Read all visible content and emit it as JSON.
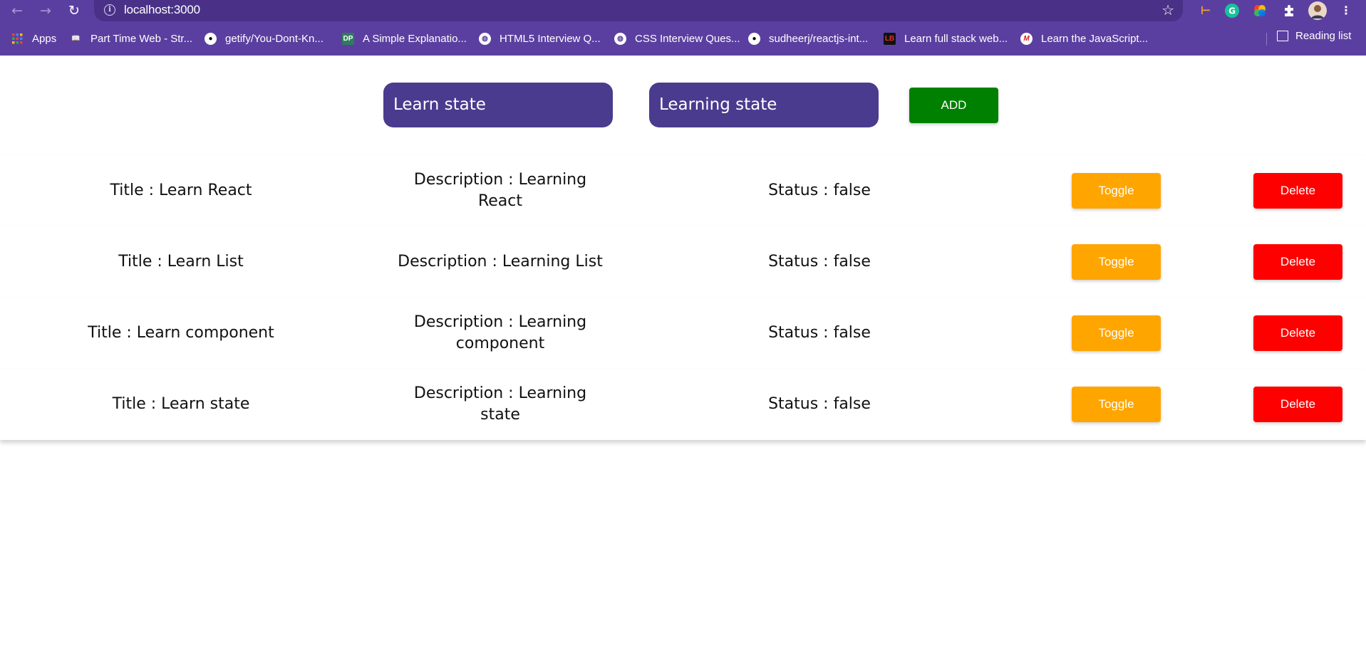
{
  "browser": {
    "url": "localhost:3000",
    "bookmarks": [
      {
        "label": "Apps",
        "icon": "apps-grid-icon"
      },
      {
        "label": "Part Time Web - Str...",
        "icon": "book-icon"
      },
      {
        "label": "getify/You-Dont-Kn...",
        "icon": "github-icon"
      },
      {
        "label": "A Simple Explanatio...",
        "icon": "dp-icon"
      },
      {
        "label": "HTML5 Interview Q...",
        "icon": "globe-icon"
      },
      {
        "label": "CSS Interview Ques...",
        "icon": "globe-icon"
      },
      {
        "label": "sudheerj/reactjs-int...",
        "icon": "github-icon"
      },
      {
        "label": "Learn full stack web...",
        "icon": "lb-icon"
      },
      {
        "label": "Learn the JavaScript...",
        "icon": "m-icon"
      }
    ],
    "reading_list_label": "Reading list",
    "colors": {
      "frame": "#5b3fa0",
      "omnibox": "#4a3187"
    }
  },
  "form": {
    "title_value": "Learn state",
    "description_value": "Learning state",
    "add_label": "ADD",
    "colors": {
      "field": "#4a3b8f",
      "add": "#008000"
    }
  },
  "todos": [
    {
      "title": "Title : Learn React",
      "description": "Description : Learning React",
      "status": "Status : false"
    },
    {
      "title": "Title : Learn List",
      "description": "Description : Learning List",
      "status": "Status : false"
    },
    {
      "title": "Title : Learn component",
      "description": "Description : Learning component",
      "status": "Status : false"
    },
    {
      "title": "Title : Learn state",
      "description": "Description : Learning state",
      "status": "Status : false"
    }
  ],
  "buttons": {
    "toggle_label": "Toggle",
    "delete_label": "Delete",
    "colors": {
      "toggle": "#ffa500",
      "delete": "#ff0000"
    }
  }
}
